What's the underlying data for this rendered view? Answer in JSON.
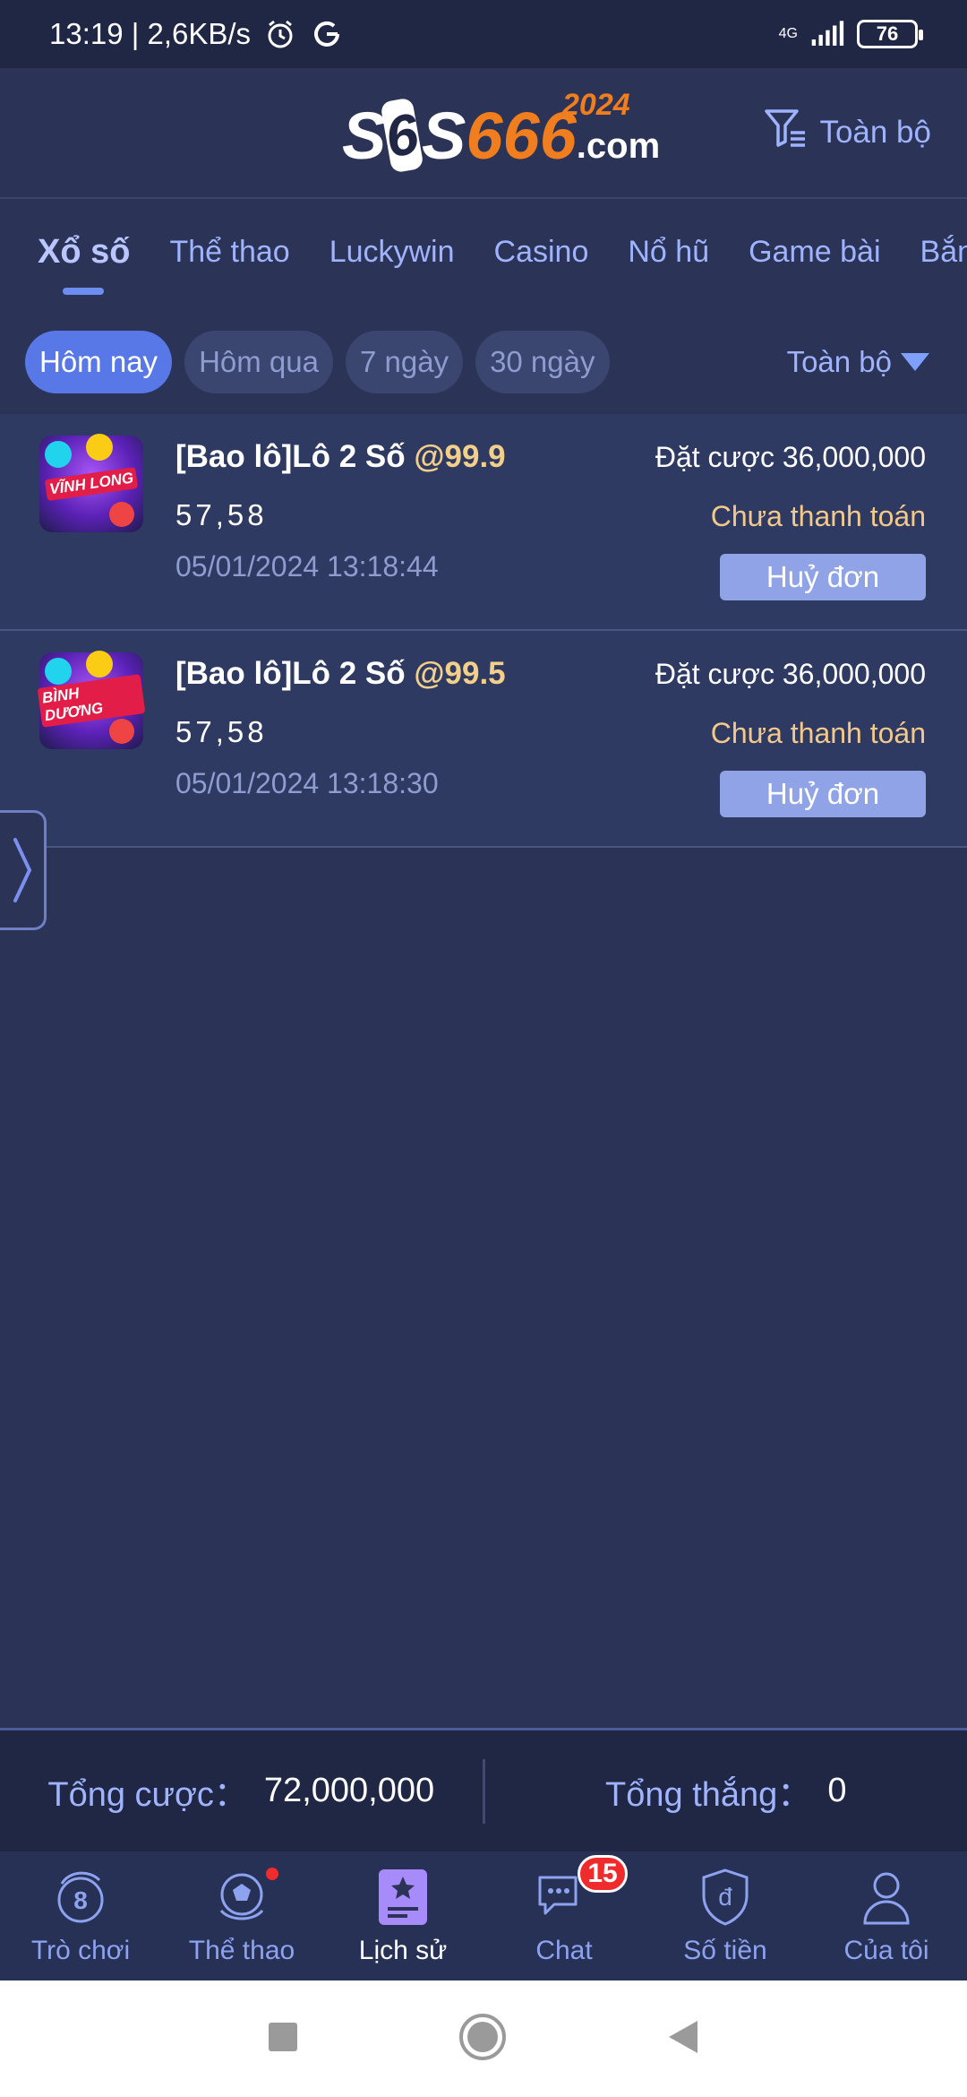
{
  "status_bar": {
    "time_speed": "13:19 | 2,6KB/s",
    "network": "4G",
    "battery": "76"
  },
  "header": {
    "logo_s": "S",
    "logo_dice": "6",
    "logo_s2": "S",
    "logo_num": "666",
    "logo_domain": ".com",
    "logo_year": "2024",
    "filter_label": "Toàn bộ"
  },
  "tabs": [
    "Xổ số",
    "Thể thao",
    "Luckywin",
    "Casino",
    "Nổ hũ",
    "Game bài",
    "Bắn"
  ],
  "date_filters": [
    "Hôm nay",
    "Hôm qua",
    "7 ngày",
    "30 ngày"
  ],
  "range_label": "Toàn bộ",
  "bets": [
    {
      "badge": "VĨNH LONG",
      "title": "[Bao lô]Lô 2 Số ",
      "odds": "@99.9",
      "numbers": "57,58",
      "time": "05/01/2024 13:18:44",
      "amount": "Đặt cược 36,000,000",
      "state": "Chưa thanh toán",
      "cancel": "Huỷ đơn"
    },
    {
      "badge": "BÌNH DƯƠNG",
      "title": "[Bao lô]Lô 2 Số ",
      "odds": "@99.5",
      "numbers": "57,58",
      "time": "05/01/2024 13:18:30",
      "amount": "Đặt cược 36,000,000",
      "state": "Chưa thanh toán",
      "cancel": "Huỷ đơn"
    }
  ],
  "totals": {
    "bet_label": "Tổng cược：",
    "bet_value": "72,000,000",
    "win_label": "Tổng thắng：",
    "win_value": "0"
  },
  "bottom_nav": [
    {
      "label": "Trò chơi",
      "icon": "dragon-icon"
    },
    {
      "label": "Thể thao",
      "icon": "soccer-ball-icon"
    },
    {
      "label": "Lịch sử",
      "icon": "history-icon"
    },
    {
      "label": "Chat",
      "icon": "chat-icon",
      "badge": "15"
    },
    {
      "label": "Số tiền",
      "icon": "wallet-shield-icon"
    },
    {
      "label": "Của tôi",
      "icon": "user-icon"
    }
  ],
  "colors": {
    "background": "#2b3457",
    "accent": "#5878e8",
    "odds": "#f3d089",
    "pending": "#f3c98b",
    "logo_orange": "#f07d1e"
  }
}
